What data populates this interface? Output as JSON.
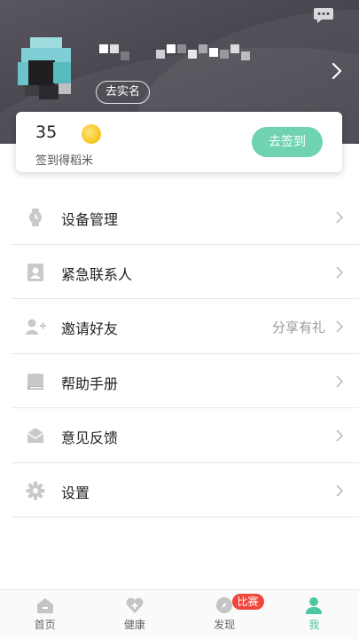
{
  "header": {
    "realname_button": "去实名"
  },
  "signin_card": {
    "points": "35",
    "subtitle": "签到得稻米",
    "signin_button": "去签到"
  },
  "menu": [
    {
      "label": "设备管理",
      "icon": "watch-icon",
      "extra": ""
    },
    {
      "label": "紧急联系人",
      "icon": "contact-card-icon",
      "extra": ""
    },
    {
      "label": "邀请好友",
      "icon": "add-user-icon",
      "extra": "分享有礼"
    },
    {
      "label": "帮助手册",
      "icon": "book-icon",
      "extra": ""
    },
    {
      "label": "意见反馈",
      "icon": "mail-icon",
      "extra": ""
    },
    {
      "label": "设置",
      "icon": "gear-icon",
      "extra": ""
    }
  ],
  "tabbar": {
    "tabs": [
      {
        "label": "首页",
        "icon": "home-icon",
        "active": false
      },
      {
        "label": "健康",
        "icon": "heart-plus-icon",
        "active": false
      },
      {
        "label": "发现",
        "icon": "compass-icon",
        "active": false,
        "badge": "比赛"
      },
      {
        "label": "我",
        "icon": "person-icon",
        "active": true
      }
    ]
  },
  "colors": {
    "accent": "#6fd3b0",
    "tab_active": "#4fc6a3",
    "badge": "#f0473c",
    "header_bg": "#4a4650"
  }
}
